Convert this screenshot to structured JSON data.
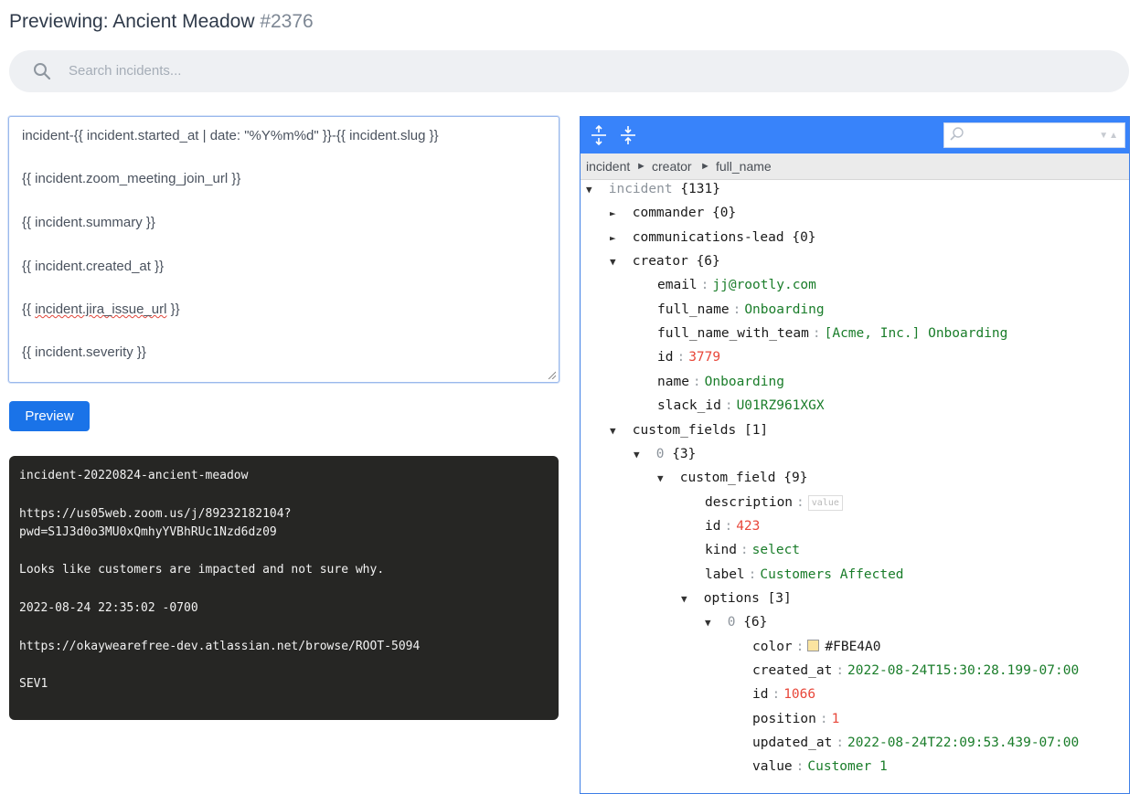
{
  "header": {
    "title": "Previewing: Ancient Meadow",
    "number": "#2376"
  },
  "search": {
    "placeholder": "Search incidents..."
  },
  "editor": {
    "lines": [
      "incident-{{ incident.started_at | date: \"%Y%m%d\" }}-{{ incident.slug }}",
      "{{ incident.zoom_meeting_join_url }}",
      "{{ incident.summary }}",
      "{{ incident.created_at }}",
      "{{ ",
      "incident.jira_issue_url",
      " }}",
      "{{ incident.severity }}"
    ]
  },
  "preview_button": {
    "label": "Preview"
  },
  "output": {
    "lines": [
      "incident-20220824-ancient-meadow",
      "https://us05web.zoom.us/j/89232182104?",
      "pwd=S1J3d0o3MU0xQmhyYVBhRUc1Nzd6dz09",
      "Looks like customers are impacted and not sure why.",
      "2022-08-24 22:35:02 -0700",
      "https://okaywearefree-dev.atlassian.net/browse/ROOT-5094",
      "SEV1"
    ]
  },
  "json_viewer": {
    "icons": {
      "expand_all": "expand-all-icon",
      "collapse_all": "collapse-all-icon",
      "search": "search-icon"
    },
    "search_value": "",
    "breadcrumb": [
      "incident",
      "creator",
      "full_name"
    ],
    "breadcrumb_sep": "►",
    "accent": "#3883fa",
    "color_swatch": "#FBE4A0",
    "rows": [
      {
        "tri": "▼",
        "key": "incident",
        "count": "{131}",
        "grey": true
      },
      {
        "tri": "►",
        "key": "commander",
        "count": "{0}"
      },
      {
        "tri": "►",
        "key": "communications-lead",
        "count": "{0}"
      },
      {
        "tri": "▼",
        "key": "creator",
        "count": "{6}"
      },
      {
        "key": "email",
        "value": "jj@rootly.com",
        "type": "str"
      },
      {
        "key": "full_name",
        "value": "Onboarding",
        "type": "str"
      },
      {
        "key": "full_name_with_team",
        "value": "[Acme, Inc.] Onboarding",
        "type": "str"
      },
      {
        "key": "id",
        "value": "3779",
        "type": "num"
      },
      {
        "key": "name",
        "value": "Onboarding",
        "type": "str"
      },
      {
        "key": "slack_id",
        "value": "U01RZ961XGX",
        "type": "str"
      },
      {
        "tri": "▼",
        "key": "custom_fields",
        "count": "[1]"
      },
      {
        "tri": "▼",
        "key": "0",
        "count": "{3}",
        "grey": true
      },
      {
        "tri": "▼",
        "key": "custom_field",
        "count": "{9}"
      },
      {
        "key": "description",
        "value": "value",
        "type": "empty"
      },
      {
        "key": "id",
        "value": "423",
        "type": "num"
      },
      {
        "key": "kind",
        "value": "select",
        "type": "str"
      },
      {
        "key": "label",
        "value": "Customers Affected",
        "type": "str"
      },
      {
        "tri": "▼",
        "key": "options",
        "count": "[3]"
      },
      {
        "tri": "▼",
        "key": "0",
        "count": "{6}",
        "grey": true
      },
      {
        "key": "color",
        "value": "#FBE4A0",
        "type": "str"
      },
      {
        "key": "created_at",
        "value": "2022-08-24T15:30:28.199-07:00",
        "type": "str"
      },
      {
        "key": "id",
        "value": "1066",
        "type": "num"
      },
      {
        "key": "position",
        "value": "1",
        "type": "num"
      },
      {
        "key": "updated_at",
        "value": "2022-08-24T22:09:53.439-07:00",
        "type": "str"
      },
      {
        "key": "value",
        "value": "Customer 1",
        "type": "str"
      }
    ]
  }
}
